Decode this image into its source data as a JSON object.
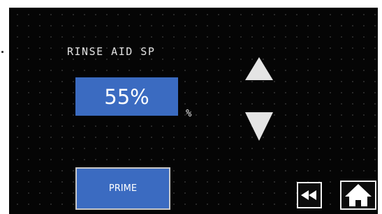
{
  "setpoint": {
    "title": "RINSE AID SP",
    "value": "55%",
    "unit": "%"
  },
  "controls": {
    "increase_icon": "up-triangle-icon",
    "decrease_icon": "down-triangle-icon",
    "prime_label": "PRIME",
    "back_icon": "rewind-icon",
    "home_icon": "home-icon"
  },
  "colors": {
    "screen_background": "#050505",
    "value_box": "#3b6bc1",
    "text": "#e2e2e2",
    "arrow": "#e4e4e4"
  }
}
